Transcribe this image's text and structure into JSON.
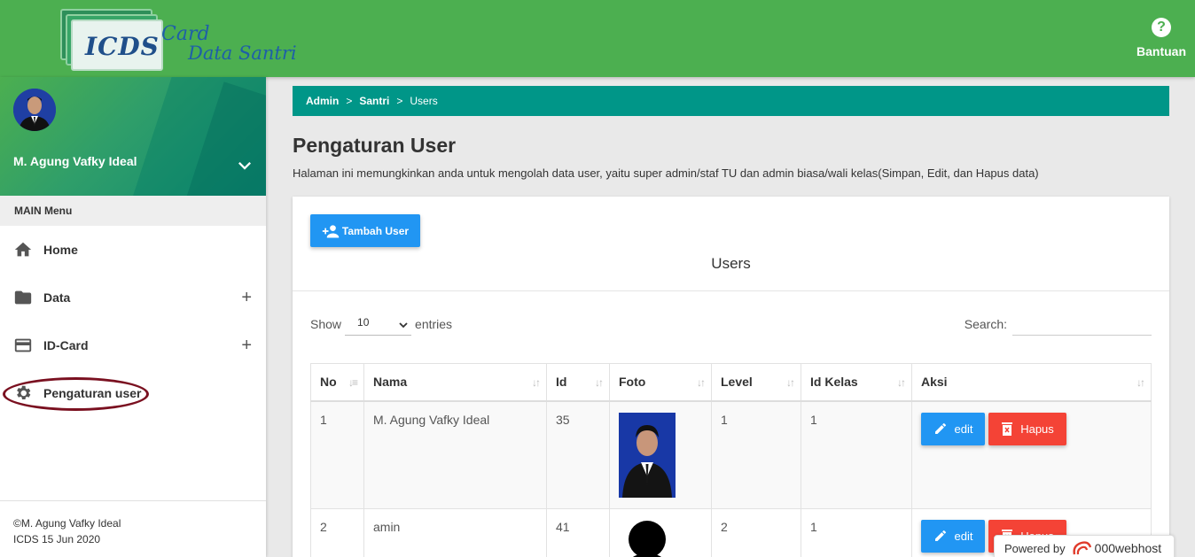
{
  "app": {
    "logo_text": "ICDS",
    "logo_script_1": "Card",
    "logo_script_2": "Data Santri",
    "help_label": "Bantuan"
  },
  "sidebar": {
    "user_name": "M. Agung Vafky Ideal",
    "menu_header": "MAIN Menu",
    "items": [
      {
        "label": "Home",
        "icon": "home-icon",
        "expandable": false
      },
      {
        "label": "Data",
        "icon": "folder-icon",
        "expandable": true
      },
      {
        "label": "ID-Card",
        "icon": "credit-card-icon",
        "expandable": true
      },
      {
        "label": "Pengaturan user",
        "icon": "gear-icon",
        "expandable": false
      }
    ],
    "footer_line1": "©M. Agung Vafky Ideal",
    "footer_line2": "ICDS 15 Jun 2020"
  },
  "breadcrumb": {
    "items": [
      "Admin",
      "Santri",
      "Users"
    ],
    "separator": ">"
  },
  "page": {
    "title": "Pengaturan User",
    "description": "Halaman ini memungkinkan anda untuk mengolah data user, yaitu super admin/staf TU dan admin biasa/wali kelas(Simpan, Edit, dan Hapus data)"
  },
  "card": {
    "add_button": "Tambah User",
    "title": "Users",
    "show_label": "Show",
    "entries_value": "10",
    "entries_label": "entries",
    "search_label": "Search:"
  },
  "table": {
    "columns": [
      "No",
      "Nama",
      "Id",
      "Foto",
      "Level",
      "Id Kelas",
      "Aksi"
    ],
    "rows": [
      {
        "no": "1",
        "nama": "M. Agung Vafky Ideal",
        "id": "35",
        "level": "1",
        "id_kelas": "1",
        "photo": "portrait-photo"
      },
      {
        "no": "2",
        "nama": "amin",
        "id": "41",
        "level": "2",
        "id_kelas": "1",
        "photo": "placeholder-silhouette"
      }
    ],
    "edit_label": "edit",
    "delete_label": "Hapus"
  },
  "powered": {
    "label": "Powered by",
    "brand": "000webhost"
  },
  "colors": {
    "topbar": "#4caf50",
    "breadcrumb": "#009688",
    "primary": "#2196f3",
    "danger": "#f44336"
  }
}
